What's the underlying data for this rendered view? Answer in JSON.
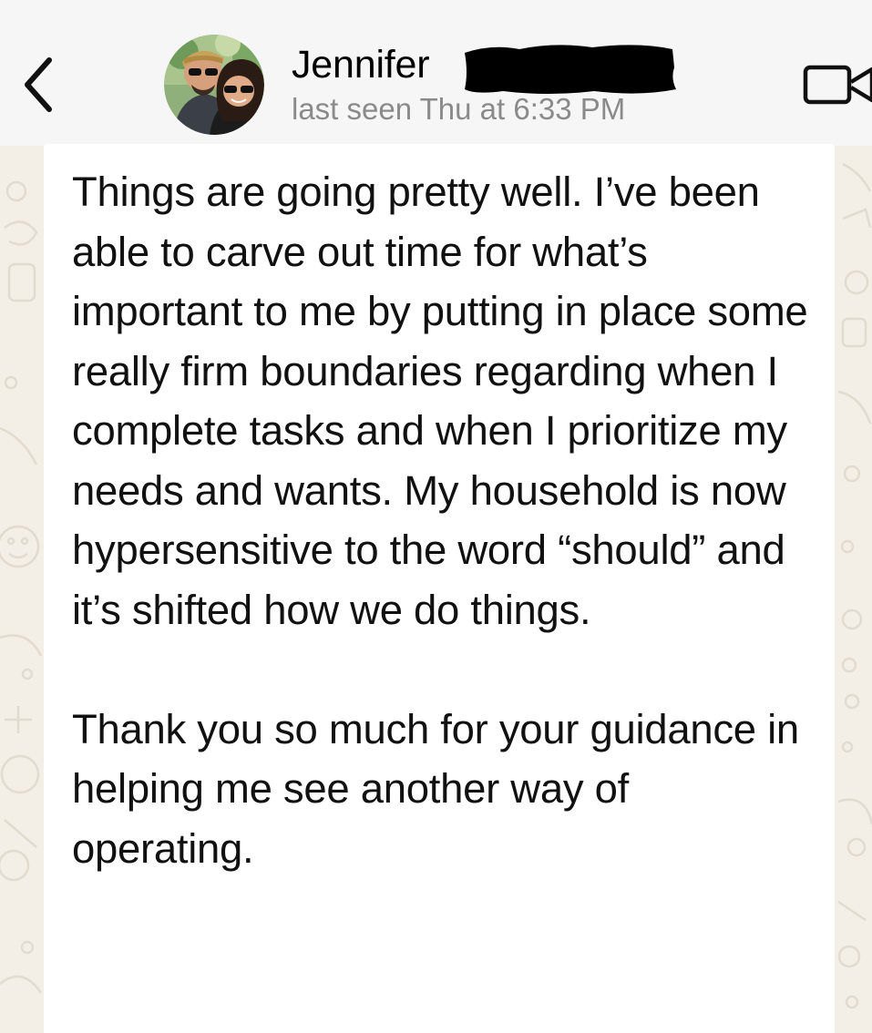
{
  "header": {
    "back_icon": "chevron-left-icon",
    "contact_name": "Jennifer",
    "last_seen": "last seen Thu at 6:33 PM",
    "video_icon": "video-camera-icon"
  },
  "message": {
    "paragraphs": [
      "Things are going pretty well. I’ve been able to carve out time for what’s important to me by putting in place some really firm boundaries regarding when I complete tasks and when I prioritize my needs and wants. My household is now hypersensitive to the word “should” and it’s shifted how we do things.",
      "Thank you so much for your guidance in helping me see another way of operating."
    ]
  },
  "colors": {
    "wallpaper": "#f3eee6",
    "header": "#f6f6f6",
    "bubble": "#ffffff",
    "text": "#111111",
    "secondary_text": "#8a8a8a"
  }
}
